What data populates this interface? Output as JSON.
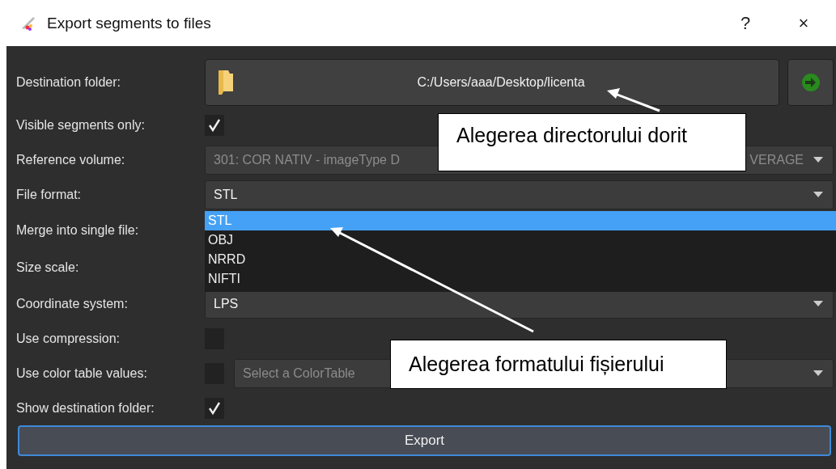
{
  "window": {
    "title": "Export segments to files",
    "buttons": [
      "?",
      "×"
    ]
  },
  "fields": [
    {
      "kind": "folder",
      "label": "Destination folder:",
      "value": "C:/Users/aaa/Desktop/licenta"
    },
    {
      "kind": "checkbox",
      "label": "Visible segments only:",
      "checked": true
    },
    {
      "kind": "combo",
      "label": "Reference volume:",
      "value": "301: COR NATIV - imageType D",
      "value_end": "VERAGE",
      "disabled": true
    },
    {
      "kind": "combo",
      "label": "File format:",
      "value": "STL",
      "disabled": false,
      "options": [
        {
          "label": "STL",
          "selected": true
        },
        {
          "label": "OBJ",
          "selected": false
        },
        {
          "label": "NRRD",
          "selected": false
        },
        {
          "label": "NIFTI",
          "selected": false
        }
      ]
    },
    {
      "kind": "covered",
      "label": "Merge into single file:"
    },
    {
      "kind": "covered",
      "label": "Size scale:"
    },
    {
      "kind": "combo",
      "label": "Coordinate system:",
      "value": "LPS",
      "disabled": false
    },
    {
      "kind": "checkbox",
      "label": "Use compression:",
      "checked": false
    },
    {
      "kind": "checkbox_combo",
      "label": "Use color table values:",
      "checked": false,
      "placeholder": "Select a ColorTable"
    },
    {
      "kind": "checkbox",
      "label": "Show destination folder:",
      "checked": true
    }
  ],
  "export_button": "Export",
  "callouts": [
    "Alegerea directorului dorit",
    "Alegerea formatului fișierului"
  ]
}
